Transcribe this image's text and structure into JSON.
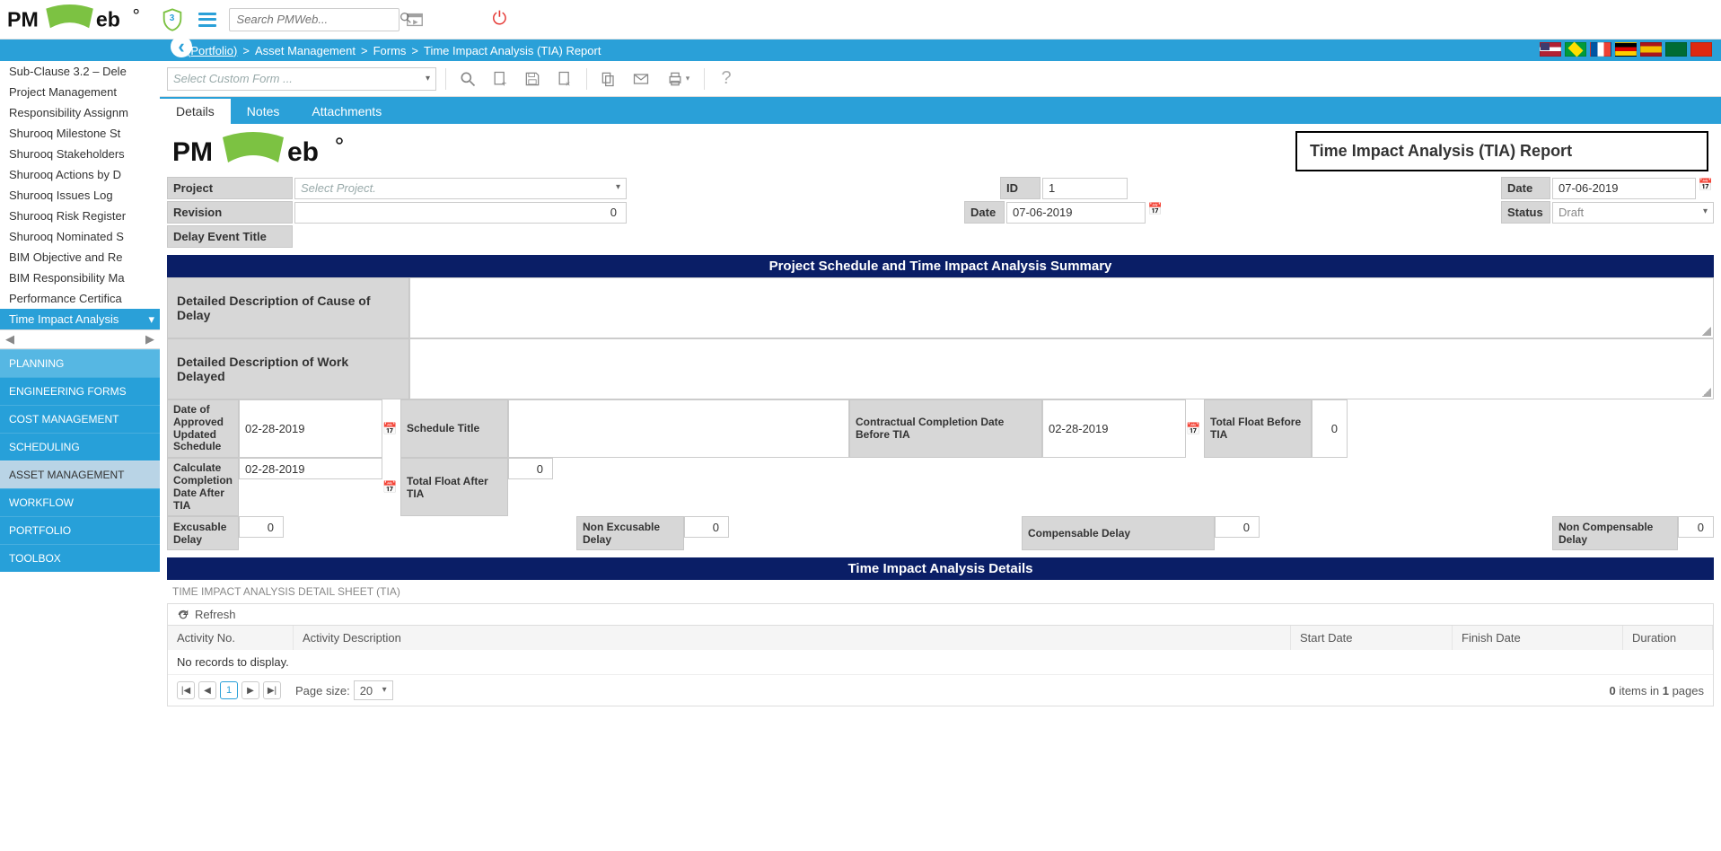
{
  "top": {
    "shield_count": "3",
    "search_placeholder": "Search PMWeb..."
  },
  "breadcrumb": {
    "root": "(Portfolio)",
    "p1": "Asset Management",
    "p2": "Forms",
    "p3": "Time Impact Analysis (TIA) Report"
  },
  "tree": {
    "items": [
      "Sub-Clause 3.2 – Dele",
      "Project Management",
      "Responsibility Assignm",
      "Shurooq Milestone St",
      "Shurooq Stakeholders",
      "Shurooq Actions by D",
      "Shurooq Issues Log",
      "Shurooq Risk Register",
      "Shurooq Nominated S",
      "BIM Objective and Re",
      "BIM Responsibility Ma",
      "Performance Certifica",
      "Time Impact Analysis"
    ]
  },
  "nav": {
    "planning": "PLANNING",
    "eng": "ENGINEERING FORMS",
    "cost": "COST MANAGEMENT",
    "sched": "SCHEDULING",
    "asset": "ASSET MANAGEMENT",
    "wf": "WORKFLOW",
    "port": "PORTFOLIO",
    "tool": "TOOLBOX"
  },
  "toolbar": {
    "custom_form_placeholder": "Select Custom Form ..."
  },
  "tabs": {
    "details": "Details",
    "notes": "Notes",
    "attachments": "Attachments"
  },
  "report_title": "Time Impact Analysis (TIA) Report",
  "hdr": {
    "project_lbl": "Project",
    "project_ph": "Select Project.",
    "id_lbl": "ID",
    "id_val": "1",
    "date_lbl": "Date",
    "date_val": "07-06-2019",
    "rev_lbl": "Revision",
    "rev_val": "0",
    "date2_lbl": "Date",
    "date2_val": "07-06-2019",
    "status_lbl": "Status",
    "status_val": "Draft",
    "delay_title_lbl": "Delay Event Title"
  },
  "section1_title": "Project Schedule and Time Impact Analysis Summary",
  "s1": {
    "cause_lbl": "Detailed Description of Cause of Delay",
    "work_lbl": "Detailed Description of Work Delayed",
    "date_approved_lbl": "Date of Approved Updated Schedule",
    "date_approved_val": "02-28-2019",
    "sched_title_lbl": "Schedule Title",
    "contract_before_lbl": "Contractual Completion Date Before TIA",
    "contract_before_val": "02-28-2019",
    "float_before_lbl": "Total Float Before TIA",
    "float_before_val": "0",
    "calc_after_lbl": "Calculate Completion Date After TIA",
    "calc_after_val": "02-28-2019",
    "float_after_lbl": "Total Float After TIA",
    "float_after_val": "0",
    "excusable_lbl": "Excusable Delay",
    "excusable_val": "0",
    "nonexcusable_lbl": "Non Excusable Delay",
    "nonexcusable_val": "0",
    "compensable_lbl": "Compensable Delay",
    "compensable_val": "0",
    "noncompensable_lbl": "Non Compensable Delay",
    "noncompensable_val": "0"
  },
  "section2_title": "Time Impact Analysis Details",
  "detail_sheet_lbl": "TIME IMPACT ANALYSIS DETAIL SHEET (TIA)",
  "refresh_lbl": "Refresh",
  "cols": {
    "act_no": "Activity No.",
    "act_desc": "Activity Description",
    "start": "Start Date",
    "finish": "Finish Date",
    "dur": "Duration"
  },
  "no_records": "No records to display.",
  "pager": {
    "page": "1",
    "size_lbl": "Page size:",
    "size_val": "20",
    "info_pre": "0",
    "info_mid": " items in ",
    "info_pages": "1",
    "info_post": " pages"
  }
}
